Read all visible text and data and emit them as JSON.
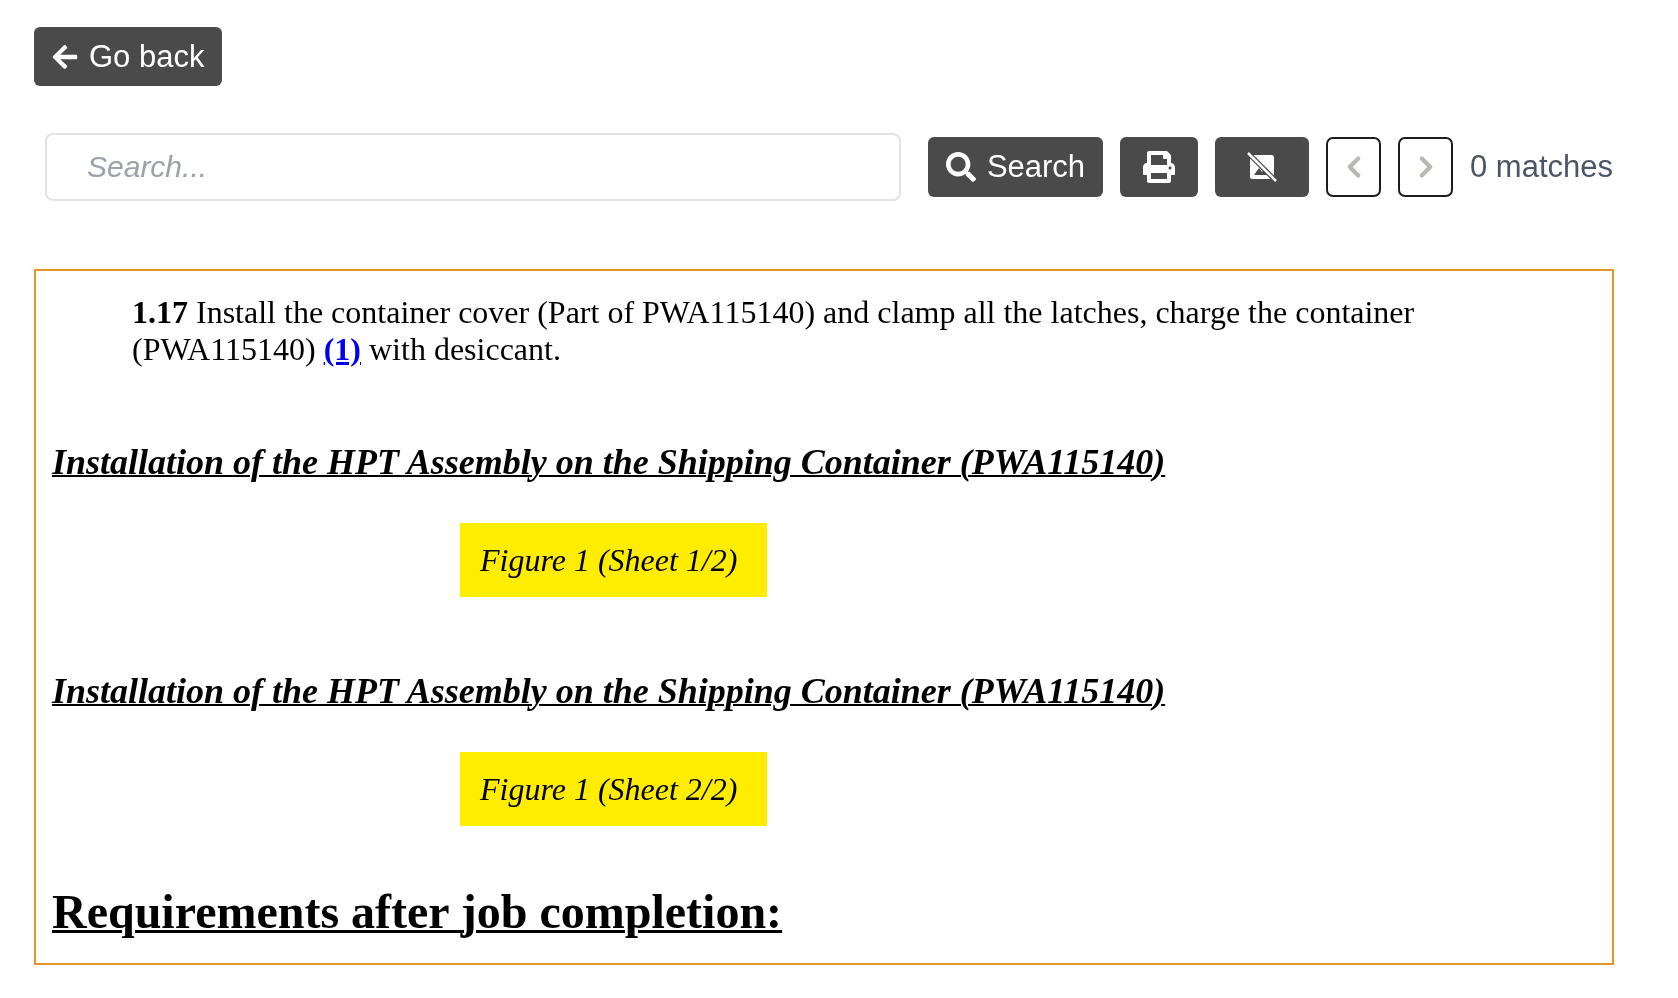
{
  "back_button": {
    "label": "Go back"
  },
  "search_bar": {
    "placeholder": "Search...",
    "search_button": "Search",
    "prev_button": {
      "disabled": true
    },
    "next_button": {
      "disabled": true
    },
    "match_count": "0 matches"
  },
  "document": {
    "blocks": [
      {
        "kind": "step",
        "text": "**1.17** Install the container cover (Part of PWA115140) and clamp all the latches, charge the container (PWA115140)",
        "link": "(1)",
        "text_after": "with desiccant."
      },
      {
        "kind": "subheading",
        "text": "Installation of the HPT Assembly on the Shipping Container (PWA115140)"
      },
      {
        "kind": "figure",
        "text": "Figure 1 (Sheet 1/2)"
      },
      {
        "kind": "subheading",
        "text": "Installation of the HPT Assembly on the Shipping Container (PWA115140)"
      },
      {
        "kind": "figure",
        "text": "Figure 1 (Sheet 2/2)"
      },
      {
        "kind": "heading",
        "text": "Requirements after job completion:"
      }
    ]
  }
}
